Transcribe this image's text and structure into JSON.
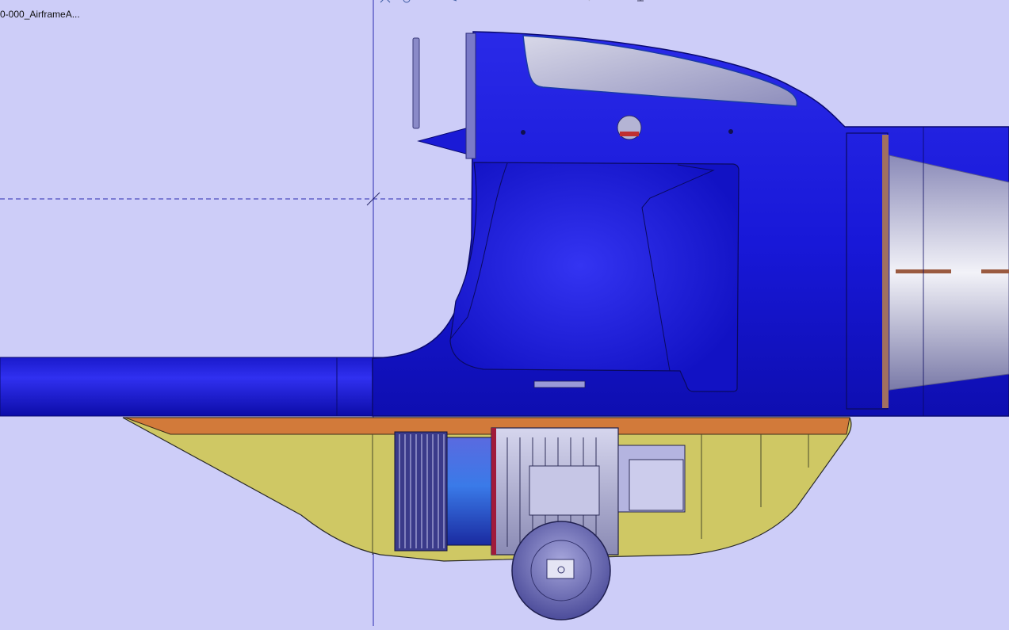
{
  "app": {
    "viewport_background": "#cdcdf8",
    "tree_root_label": "0-000_AirframeA..."
  },
  "toolbar": {
    "buttons": [
      {
        "icon": "fly-mode-icon"
      },
      {
        "icon": "zoom-icon"
      },
      {
        "icon": "pan-icon"
      },
      {
        "icon": "rotate-icon"
      },
      {
        "icon": "normal-view-icon"
      },
      {
        "icon": "iso-view-icon"
      },
      {
        "icon": "hide-show-icon"
      },
      {
        "icon": "render-style-icon"
      },
      {
        "icon": "pointer-icon"
      },
      {
        "icon": "grid-icon"
      },
      {
        "icon": "compass-icon"
      }
    ]
  },
  "model": {
    "fuselage_color": "#1a1ad6",
    "canopy_color": "#b9b9d2",
    "pod_color": "#cfc864",
    "pod_rim_color": "#d27a3a",
    "motor_color": "#3a50c8",
    "wheel_color": "#6a6ab4"
  }
}
